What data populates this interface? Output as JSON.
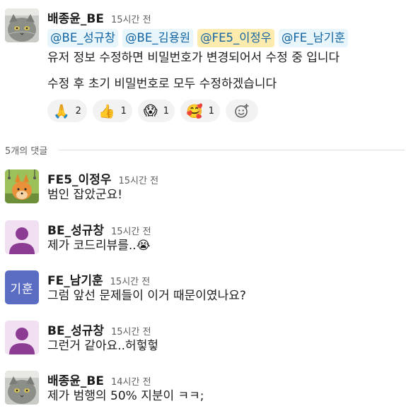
{
  "parent": {
    "author": "배종윤_BE",
    "time": "15시간 전",
    "mentions": [
      "@BE_성규창",
      "@BE_김용원",
      "@FE5_이정우",
      "@FE_남기훈"
    ],
    "line1": "유저 정보 수정하면 비밀번호가 변경되어서 수정 중 입니다",
    "line2": "수정 후 초기 비밀번호로 모두 수정하겠습니다",
    "reactions": [
      {
        "emoji": "🙏",
        "count": "2"
      },
      {
        "emoji": "👍",
        "count": "1"
      },
      {
        "emoji": "😱",
        "count": "1"
      },
      {
        "emoji": "🥰",
        "count": "1"
      }
    ],
    "add_reaction_icon": "add-emoji-icon"
  },
  "thread": {
    "reply_count_label": "5개의 댓글",
    "replies": [
      {
        "author": "FE5_이정우",
        "time": "15시간 전",
        "text": "범인 잡았군요!"
      },
      {
        "author": "BE_성규창",
        "time": "15시간 전",
        "text": "제가 코드리뷰를..😭"
      },
      {
        "author": "FE_남기훈",
        "time": "15시간 전",
        "text": "그럼 앞선 문제들이 이거 때문이였나요?",
        "avatar_text": "기훈"
      },
      {
        "author": "BE_성규창",
        "time": "15시간 전",
        "text": "그런거 같아요..허헣헣"
      },
      {
        "author": "배종윤_BE",
        "time": "14시간 전",
        "text": "제가 범행의 50% 지분이 ㅋㅋ;"
      }
    ]
  },
  "colors": {
    "mention_bg": "#e8f5fa",
    "mention_self_bg": "#fdeaad",
    "mention_text": "#1264a3",
    "avatar_kihun": "#5b6dc2",
    "avatar_person": "#8d3c94"
  }
}
